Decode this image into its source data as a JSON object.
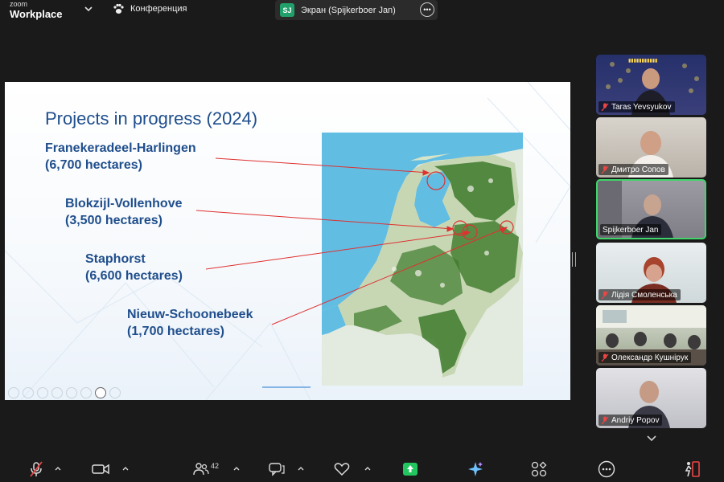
{
  "app": {
    "brand_top": "zoom",
    "brand_bottom": "Workplace"
  },
  "meeting": {
    "title": "Конференция"
  },
  "share": {
    "initials": "SJ",
    "label": "Экран (Spijkerboer Jan)"
  },
  "slide": {
    "title": "Projects in progress (2024)",
    "projects": [
      {
        "name": "Franekeradeel-Harlingen",
        "area": "(6,700 hectares)"
      },
      {
        "name": "Blokzijl-Vollenhove",
        "area": "(3,500 hectares)"
      },
      {
        "name": "Staphorst",
        "area": "(6,600 hectares)"
      },
      {
        "name": "Nieuw-Schoonebeek",
        "area": "(1,700 hectares)"
      }
    ],
    "colors": {
      "title": "#1f4e8c",
      "leader": "#e03030",
      "forest": "#3d7a2a",
      "water": "#5bb8df"
    }
  },
  "participants": [
    {
      "name": "Taras Yevsyukov",
      "muted": true,
      "active": false
    },
    {
      "name": "Дмитро Сопов",
      "muted": true,
      "active": false
    },
    {
      "name": "Spijkerboer Jan",
      "muted": false,
      "active": true
    },
    {
      "name": "Лідія Смоленська",
      "muted": true,
      "active": false
    },
    {
      "name": "Олександр Кушнірук",
      "muted": true,
      "active": false
    },
    {
      "name": "Andriy Popov",
      "muted": true,
      "active": false
    }
  ],
  "toolbar": {
    "participants_count": "42",
    "icons": [
      "mic-muted-icon",
      "video-icon",
      "participants-icon",
      "chat-icon",
      "heart-icon",
      "share-screen-icon",
      "ai-companion-icon",
      "apps-icon",
      "more-icon",
      "leave-icon"
    ],
    "share_color": "#22c55e"
  }
}
